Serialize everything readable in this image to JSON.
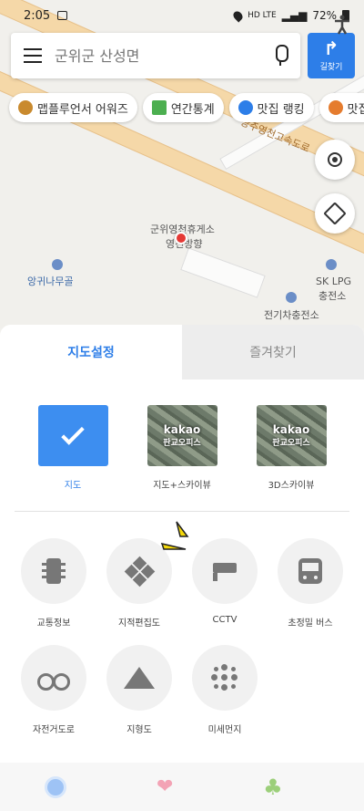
{
  "status_bar": {
    "time": "2:05",
    "network": "HD LTE",
    "battery": "72%"
  },
  "search": {
    "placeholder": "군위군 산성면",
    "route_label": "길찾기"
  },
  "chips": [
    {
      "label": "맵플루언서 어워즈",
      "icon_color": "#c98a2e"
    },
    {
      "label": "연간통계",
      "icon_color": "#4caf50"
    },
    {
      "label": "맛집 랭킹",
      "icon_color": "#2d7ee8"
    },
    {
      "label": "맛집",
      "icon_color": "#e57c2e"
    }
  ],
  "map_labels": {
    "highway": "상주영천고속도로",
    "rest_area": "군위영천휴게소",
    "rest_area_sub": "영천방향",
    "valley": "앙귀나무골",
    "gas": "SK LPG",
    "gas_sub": "충전소",
    "ev": "전기차충전소"
  },
  "sheet": {
    "tabs": [
      {
        "label": "지도설정",
        "active": true
      },
      {
        "label": "즐겨찾기",
        "active": false
      }
    ],
    "map_types": [
      {
        "label": "지도",
        "selected": true,
        "thumb_text_1": "kakao",
        "thumb_text_2": "판교오피스"
      },
      {
        "label": "지도+스카이뷰",
        "selected": false,
        "thumb_text_1": "kakao",
        "thumb_text_2": "판교오피스"
      },
      {
        "label": "3D스카이뷰",
        "selected": false,
        "thumb_text_1": "kakao",
        "thumb_text_2": "판교오피스"
      }
    ],
    "overlays_row1": [
      {
        "label": "교통정보",
        "icon": "traffic-light-icon"
      },
      {
        "label": "지적편집도",
        "icon": "cadastral-icon"
      },
      {
        "label": "CCTV",
        "icon": "cctv-icon"
      },
      {
        "label": "초정밀 버스",
        "icon": "bus-icon"
      }
    ],
    "overlays_row2": [
      {
        "label": "자전거도로",
        "icon": "bicycle-icon"
      },
      {
        "label": "지형도",
        "icon": "terrain-icon"
      },
      {
        "label": "미세먼지",
        "icon": "dust-icon"
      }
    ]
  },
  "colors": {
    "accent": "#2d7ee8",
    "selected_thumb": "#3d8ef0",
    "marker": "#e53935",
    "sparkle": "#f5d90a"
  }
}
